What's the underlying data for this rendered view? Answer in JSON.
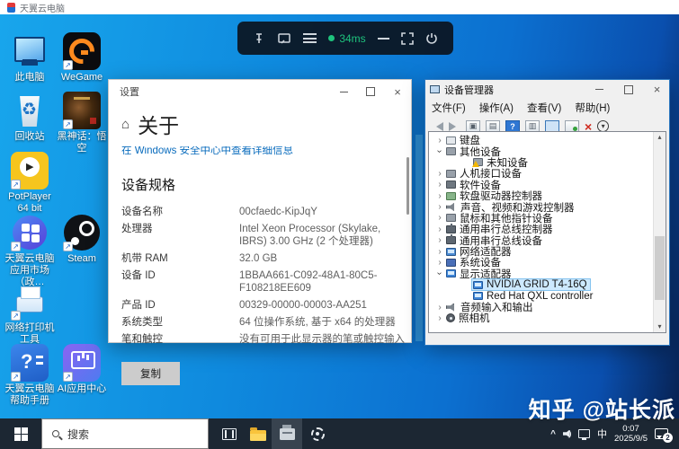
{
  "client": {
    "title": "天翼云电脑",
    "toolbar": {
      "latency": "34ms"
    }
  },
  "desktop": {
    "icons": [
      {
        "label": "此电脑",
        "kind": "this-pc",
        "col": "1",
        "row": "1",
        "shortcut": "false"
      },
      {
        "label": "WeGame",
        "kind": "wegame",
        "col": "2",
        "row": "1",
        "shortcut": "true"
      },
      {
        "label": "回收站",
        "kind": "recycle",
        "col": "1",
        "row": "2",
        "shortcut": "false"
      },
      {
        "label": "黑神话：悟空",
        "kind": "wukong",
        "col": "2",
        "row": "2",
        "shortcut": "true"
      },
      {
        "label": "PotPlayer 64 bit",
        "kind": "potplayer",
        "col": "1",
        "row": "3",
        "shortcut": "true"
      },
      {
        "label": "天翼云电脑应用市场（政…",
        "kind": "market",
        "col": "1",
        "row": "4",
        "shortcut": "true"
      },
      {
        "label": "Steam",
        "kind": "steam",
        "col": "2",
        "row": "4",
        "shortcut": "true"
      },
      {
        "label": "网络打印机工具",
        "kind": "printer",
        "col": "1",
        "row": "5",
        "shortcut": "true"
      },
      {
        "label": "天翼云电脑帮助手册",
        "kind": "helpbook",
        "col": "1",
        "row": "6",
        "shortcut": "true"
      },
      {
        "label": "AI应用中心",
        "kind": "ai",
        "col": "2",
        "row": "6",
        "shortcut": "true"
      }
    ]
  },
  "settings_window": {
    "title": "设置",
    "page_title": "关于",
    "security_link": "在 Windows 安全中心中查看详细信息",
    "section_title": "设备规格",
    "specs": [
      {
        "label": "设备名称",
        "value": "00cfaedc-KipJqY"
      },
      {
        "label": "处理器",
        "value": "Intel Xeon Processor (Skylake, IBRS)  3.00 GHz  (2 个处理器)"
      },
      {
        "label": "机带 RAM",
        "value": "32.0 GB"
      },
      {
        "label": "设备 ID",
        "value": "1BBAA661-C092-48A1-80C5-F108218EE609"
      },
      {
        "label": "产品 ID",
        "value": "00329-00000-00003-AA251"
      },
      {
        "label": "系统类型",
        "value": "64 位操作系统, 基于 x64 的处理器"
      },
      {
        "label": "笔和触控",
        "value": "没有可用于此显示器的笔或触控输入"
      }
    ],
    "copy_button": "复制"
  },
  "device_manager": {
    "title": "设备管理器",
    "menu": [
      {
        "label": "文件(F)"
      },
      {
        "label": "操作(A)"
      },
      {
        "label": "查看(V)"
      },
      {
        "label": "帮助(H)"
      }
    ],
    "tree": [
      {
        "label": "键盘",
        "level": "1",
        "state": "collapsed",
        "icon": "keyboard",
        "selected": "false"
      },
      {
        "label": "其他设备",
        "level": "1",
        "state": "expanded",
        "icon": "other",
        "selected": "false"
      },
      {
        "label": "未知设备",
        "level": "2",
        "state": "none",
        "icon": "unknown",
        "selected": "false"
      },
      {
        "label": "人机接口设备",
        "level": "1",
        "state": "collapsed",
        "icon": "hid",
        "selected": "false"
      },
      {
        "label": "软件设备",
        "level": "1",
        "state": "collapsed",
        "icon": "software",
        "selected": "false"
      },
      {
        "label": "软盘驱动器控制器",
        "level": "1",
        "state": "collapsed",
        "icon": "floppy",
        "selected": "false"
      },
      {
        "label": "声音、视频和游戏控制器",
        "level": "1",
        "state": "collapsed",
        "icon": "sound",
        "selected": "false"
      },
      {
        "label": "鼠标和其他指针设备",
        "level": "1",
        "state": "collapsed",
        "icon": "mouse",
        "selected": "false"
      },
      {
        "label": "通用串行总线控制器",
        "level": "1",
        "state": "collapsed",
        "icon": "usb",
        "selected": "false"
      },
      {
        "label": "通用串行总线设备",
        "level": "1",
        "state": "collapsed",
        "icon": "usb",
        "selected": "false"
      },
      {
        "label": "网络适配器",
        "level": "1",
        "state": "collapsed",
        "icon": "network",
        "selected": "false"
      },
      {
        "label": "系统设备",
        "level": "1",
        "state": "collapsed",
        "icon": "system",
        "selected": "false"
      },
      {
        "label": "显示适配器",
        "level": "1",
        "state": "expanded",
        "icon": "display",
        "selected": "false"
      },
      {
        "label": "NVIDIA GRID T4-16Q",
        "level": "2",
        "state": "none",
        "icon": "display",
        "selected": "true"
      },
      {
        "label": "Red Hat QXL controller",
        "level": "2",
        "state": "none",
        "icon": "display",
        "selected": "false"
      },
      {
        "label": "音频输入和输出",
        "level": "1",
        "state": "collapsed",
        "icon": "audio",
        "selected": "false"
      },
      {
        "label": "照相机",
        "level": "1",
        "state": "collapsed",
        "icon": "camera",
        "selected": "false"
      }
    ]
  },
  "taskbar": {
    "search_placeholder": "搜索",
    "tray": {
      "ime": "中",
      "time": "0:07",
      "date": "2025/9/5",
      "badge": "2"
    }
  },
  "watermark": "知乎 @站长派"
}
